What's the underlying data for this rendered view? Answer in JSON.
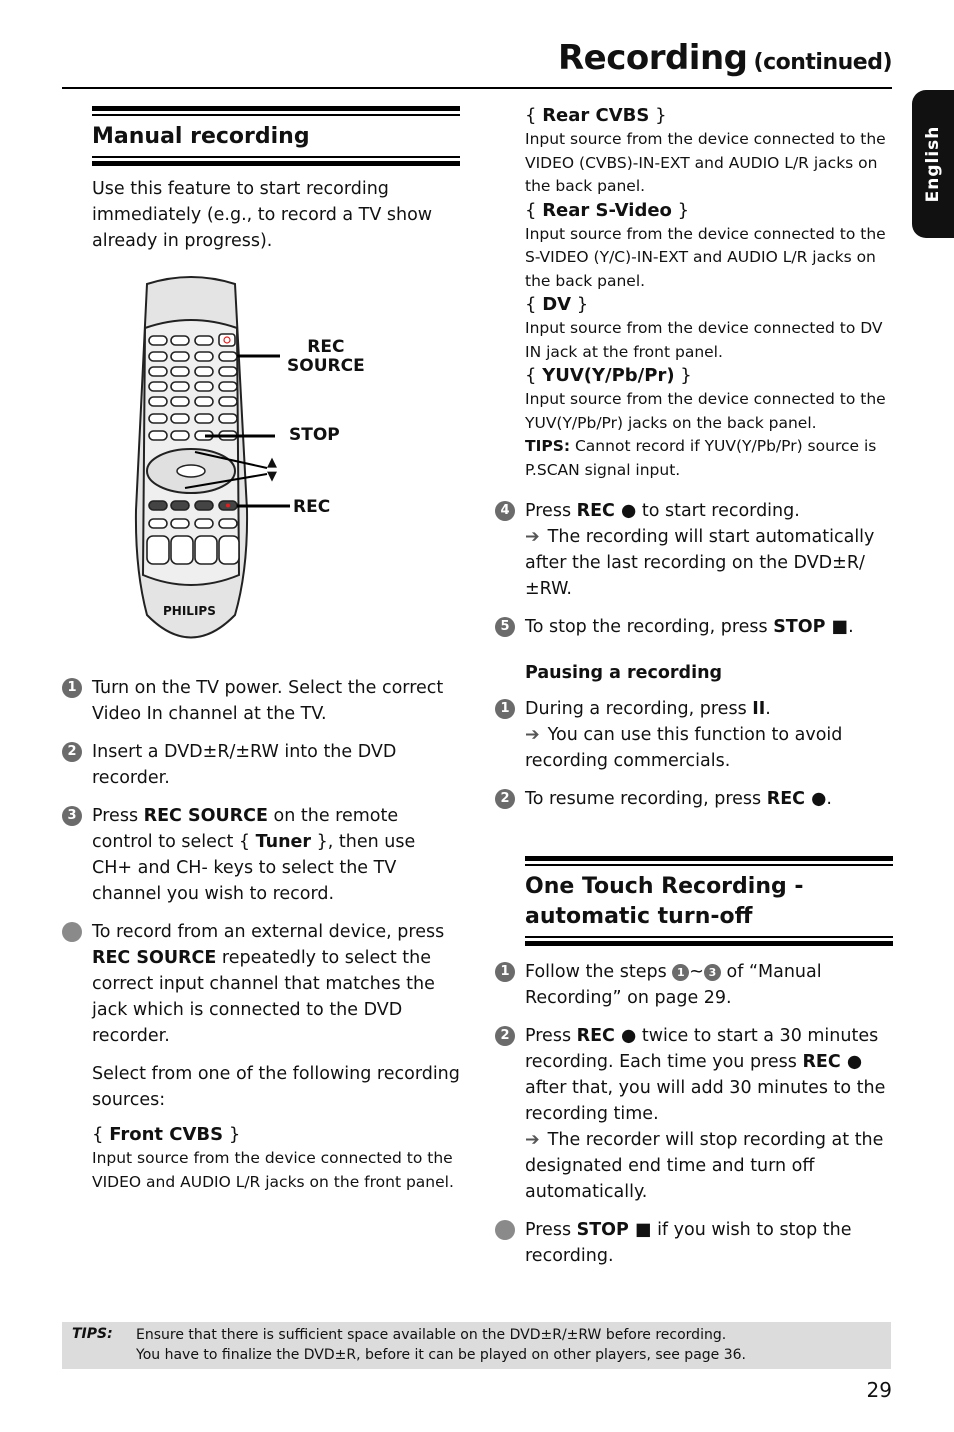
{
  "header": {
    "title": "Recording",
    "continued": "(continued)"
  },
  "language_tab": "English",
  "manual_recording": {
    "title": "Manual recording",
    "intro": "Use this feature to start recording immediately (e.g., to record a TV show already in progress).",
    "remote": {
      "brand": "PHILIPS",
      "callouts": {
        "rec_source": [
          "REC",
          "SOURCE"
        ],
        "stop": "STOP",
        "rec": "REC",
        "up": "▲",
        "down": "▼"
      }
    },
    "steps": [
      {
        "num": "1",
        "text": "Turn on the TV power. Select the correct Video In channel at the TV."
      },
      {
        "num": "2",
        "text": "Insert a DVD±R/±RW into the DVD recorder."
      },
      {
        "num": "3",
        "pre": "Press ",
        "bold1": "REC SOURCE",
        "mid": " on the remote control to select { ",
        "bold2": "Tuner",
        "post": " }, then use CH+ and CH- keys to select the TV channel you wish to record."
      }
    ],
    "bullet": {
      "pre": "To record from an external device, press ",
      "bold": "REC SOURCE",
      "post": " repeatedly to select the correct input channel that matches the jack which is connected to the DVD recorder."
    },
    "select_text": "Select from one of the following recording sources:",
    "sources": [
      {
        "name": "Front CVBS",
        "desc": "Input source from the device connected to the VIDEO and AUDIO L/R jacks on the front panel."
      },
      {
        "name": "Rear CVBS",
        "desc": "Input source from the device connected to the VIDEO (CVBS)-IN-EXT and AUDIO L/R jacks on the back panel."
      },
      {
        "name": "Rear S-Video",
        "desc": "Input source from the device connected to the S-VIDEO (Y/C)-IN-EXT and AUDIO L/R jacks on the back panel."
      },
      {
        "name": "DV",
        "desc": "Input source from the device connected to DV IN jack at the front panel."
      },
      {
        "name": "YUV(Y/Pb/Pr)",
        "desc": "Input source from the device connected to the YUV(Y/Pb/Pr) jacks on the back panel."
      }
    ],
    "yuv_tip": {
      "label": "TIPS:",
      "text": " Cannot record if YUV(Y/Pb/Pr) source is P.SCAN signal input."
    },
    "step4": {
      "num": "4",
      "pre": "Press ",
      "bold": "REC ●",
      "post": " to start recording.",
      "result": "The recording will start automatically after the last recording on the DVD±R/±RW."
    },
    "step5": {
      "num": "5",
      "pre": "To stop the recording, press ",
      "bold": "STOP ■",
      "post": "."
    }
  },
  "pausing": {
    "title": "Pausing a recording",
    "step1": {
      "num": "1",
      "pre": "During a recording, press ",
      "bold": "II",
      "post": ".",
      "result": "You can use this function to avoid recording commercials."
    },
    "step2": {
      "num": "2",
      "pre": "To resume recording, press ",
      "bold": "REC ●",
      "post": "."
    }
  },
  "one_touch": {
    "title_line1": "One Touch Recording -",
    "title_line2": "automatic turn-off",
    "step1": {
      "num": "1",
      "pre": "Follow the steps ",
      "ref_a": "1",
      "tilde": "~",
      "ref_b": "3",
      "post": " of “Manual Recording” on page 29."
    },
    "step2": {
      "num": "2",
      "pre": "Press ",
      "bold1": "REC ●",
      "mid": " twice to start a 30 minutes recording. Each time you press ",
      "bold2": "REC ●",
      "post": " after that, you will add 30 minutes to the recording time.",
      "result": "The recorder will stop recording at the designated end time and turn off automatically."
    },
    "bullet": {
      "pre": "Press ",
      "bold": "STOP ■",
      "post": " if you wish to stop the recording."
    }
  },
  "footer_tips": {
    "label": "TIPS:",
    "lines": [
      "Ensure that there is sufficient space available on the DVD±R/±RW before recording.",
      "You have to finalize the DVD±R, before it can be played on other players, see page 36."
    ]
  },
  "page_number": "29"
}
